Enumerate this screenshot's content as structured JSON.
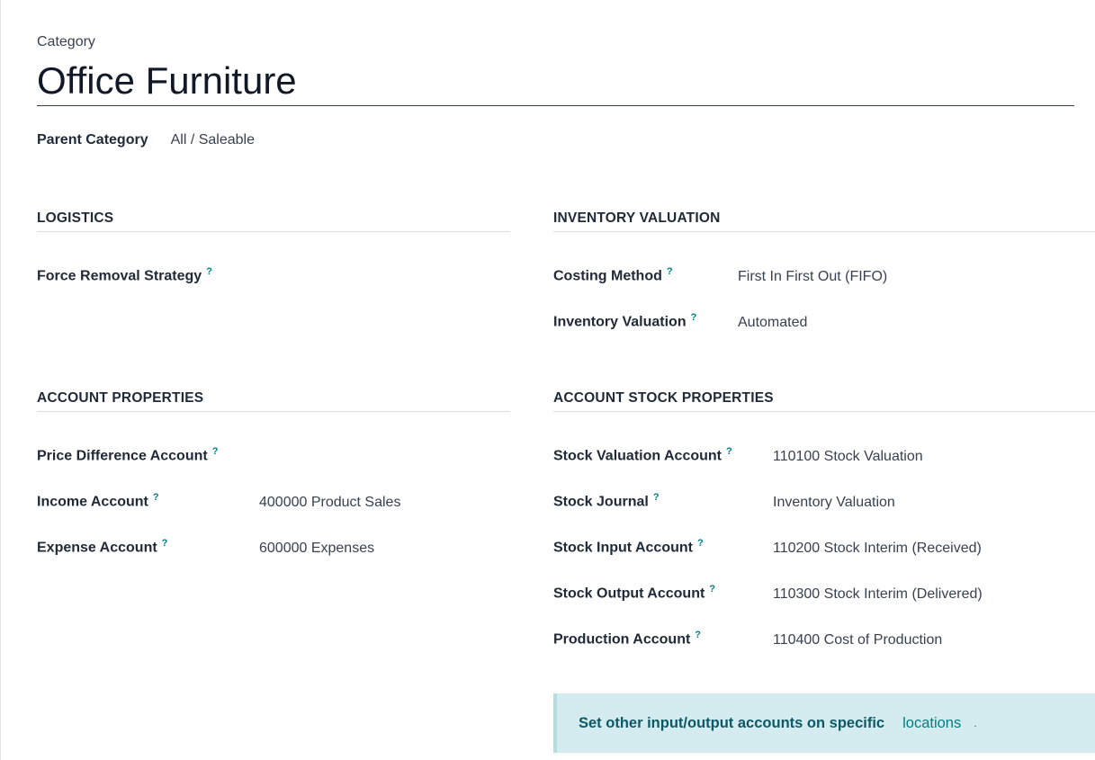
{
  "header": {
    "category_label": "Category",
    "category_name": "Office Furniture"
  },
  "parent": {
    "label": "Parent Category",
    "value": "All / Saleable"
  },
  "logistics": {
    "title": "LOGISTICS",
    "force_removal_label": "Force Removal Strategy",
    "force_removal_value": ""
  },
  "inventory_valuation": {
    "title": "INVENTORY VALUATION",
    "costing_label": "Costing Method",
    "costing_value": "First In First Out (FIFO)",
    "valuation_label": "Inventory Valuation",
    "valuation_value": "Automated"
  },
  "account_properties": {
    "title": "ACCOUNT PROPERTIES",
    "price_diff_label": "Price Difference Account",
    "price_diff_value": "",
    "income_label": "Income Account",
    "income_value": "400000 Product Sales",
    "expense_label": "Expense Account",
    "expense_value": "600000 Expenses"
  },
  "account_stock_properties": {
    "title": "ACCOUNT STOCK PROPERTIES",
    "stock_valuation_label": "Stock Valuation Account",
    "stock_valuation_value": "110100 Stock Valuation",
    "stock_journal_label": "Stock Journal",
    "stock_journal_value": "Inventory Valuation",
    "stock_input_label": "Stock Input Account",
    "stock_input_value": "110200 Stock Interim (Received)",
    "stock_output_label": "Stock Output Account",
    "stock_output_value": "110300 Stock Interim (Delivered)",
    "production_label": "Production Account",
    "production_value": "110400 Cost of Production"
  },
  "alert": {
    "text": "Set other input/output accounts on specific",
    "link": "locations",
    "dot": "."
  },
  "help_mark": "?",
  "colors": {
    "accent": "#017e84",
    "alert_bg": "#d4ebef",
    "alert_text": "#0e5966"
  }
}
